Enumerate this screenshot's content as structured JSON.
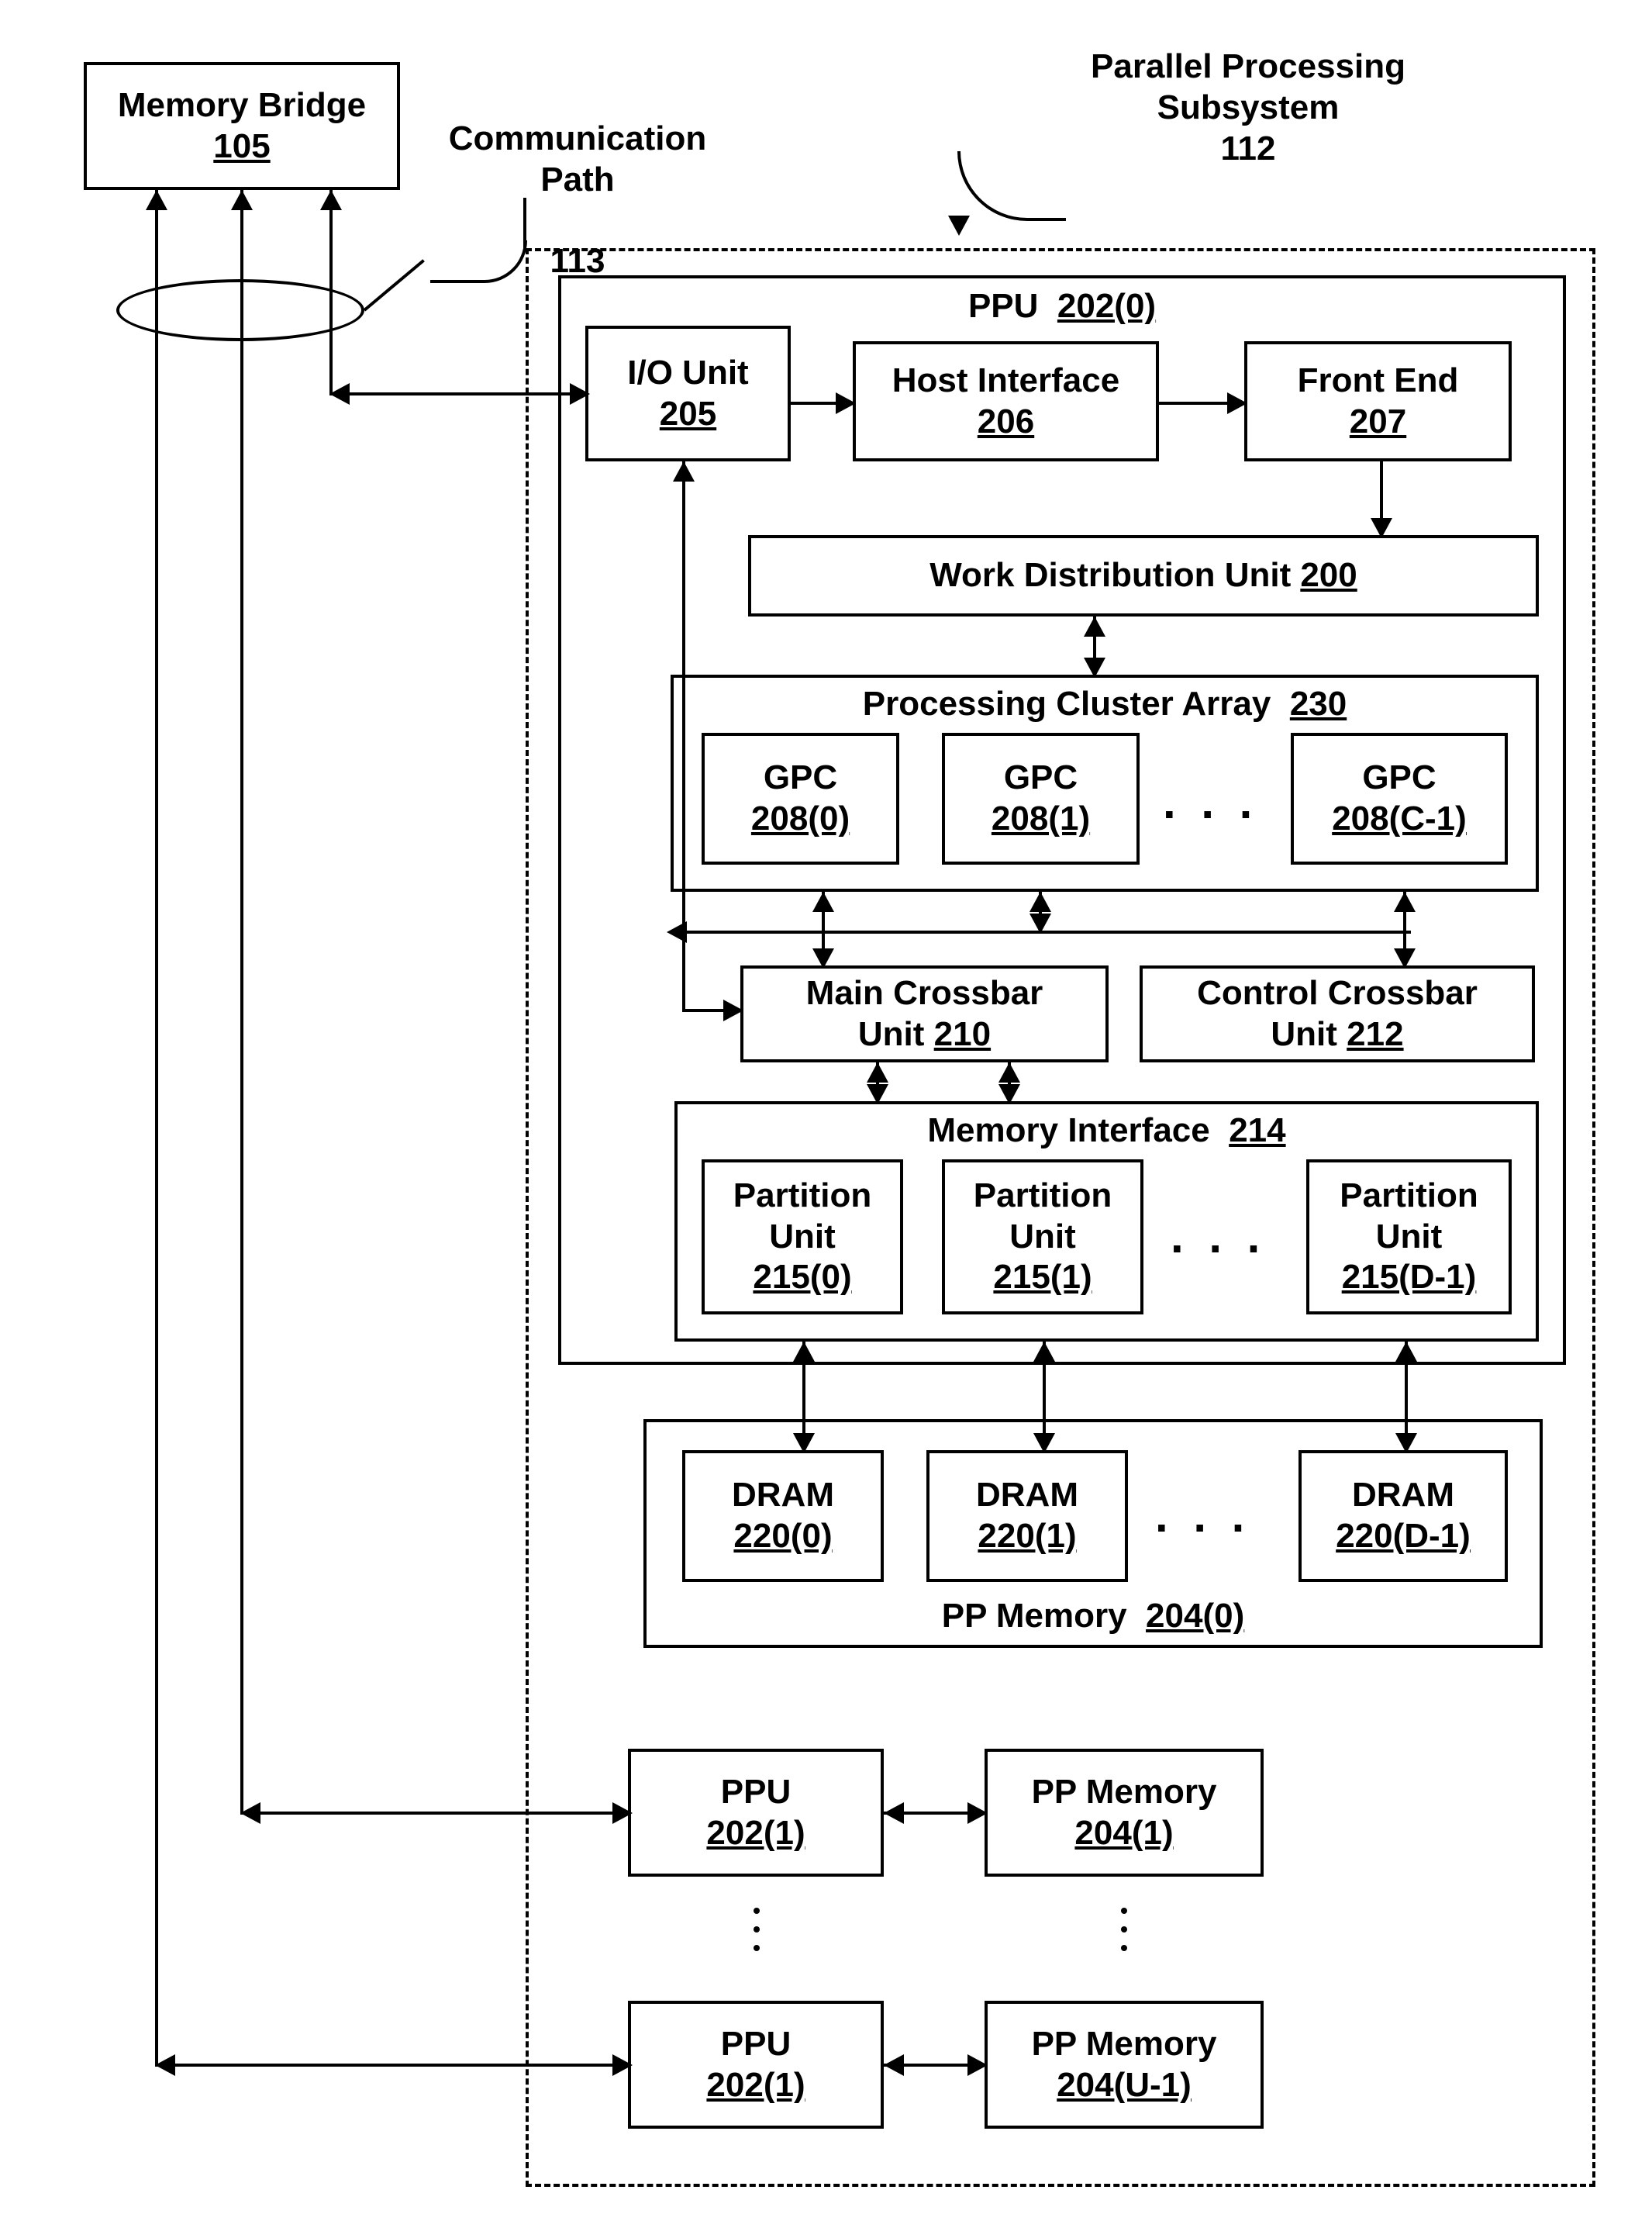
{
  "memory_bridge": {
    "title": "Memory Bridge",
    "ref": "105"
  },
  "comm_path": {
    "title": "Communication\nPath",
    "ref": "113"
  },
  "subsystem": {
    "title": "Parallel Processing\nSubsystem",
    "ref": "112"
  },
  "ppu0": {
    "label": "PPU",
    "ref": "202(0)"
  },
  "io_unit": {
    "title": "I/O Unit",
    "ref": "205"
  },
  "host_if": {
    "title": "Host Interface",
    "ref": "206"
  },
  "front_end": {
    "title": "Front End",
    "ref": "207"
  },
  "work_dist": {
    "title": "Work Distribution Unit",
    "ref": "200"
  },
  "pca": {
    "title": "Processing Cluster Array",
    "ref": "230"
  },
  "gpc0": {
    "title": "GPC",
    "ref": "208(0)"
  },
  "gpc1": {
    "title": "GPC",
    "ref": "208(1)"
  },
  "gpcN": {
    "title": "GPC",
    "ref": "208(C-1)"
  },
  "main_xbar": {
    "title": "Main Crossbar\nUnit",
    "ref": "210"
  },
  "ctrl_xbar": {
    "title": "Control Crossbar\nUnit",
    "ref": "212"
  },
  "mem_if": {
    "title": "Memory Interface",
    "ref": "214"
  },
  "pu0": {
    "title": "Partition\nUnit",
    "ref": "215(0)"
  },
  "pu1": {
    "title": "Partition\nUnit",
    "ref": "215(1)"
  },
  "puN": {
    "title": "Partition\nUnit",
    "ref": "215(D-1)"
  },
  "dram0": {
    "title": "DRAM",
    "ref": "220(0)"
  },
  "dram1": {
    "title": "DRAM",
    "ref": "220(1)"
  },
  "dramN": {
    "title": "DRAM",
    "ref": "220(D-1)"
  },
  "pp_mem0": {
    "title": "PP Memory",
    "ref": "204(0)"
  },
  "ppu1": {
    "title": "PPU",
    "ref": "202(1)"
  },
  "pp_mem1": {
    "title": "PP Memory",
    "ref": "204(1)"
  },
  "ppuU": {
    "title": "PPU",
    "ref": "202(1)"
  },
  "pp_memU": {
    "title": "PP Memory",
    "ref": "204(U-1)"
  }
}
